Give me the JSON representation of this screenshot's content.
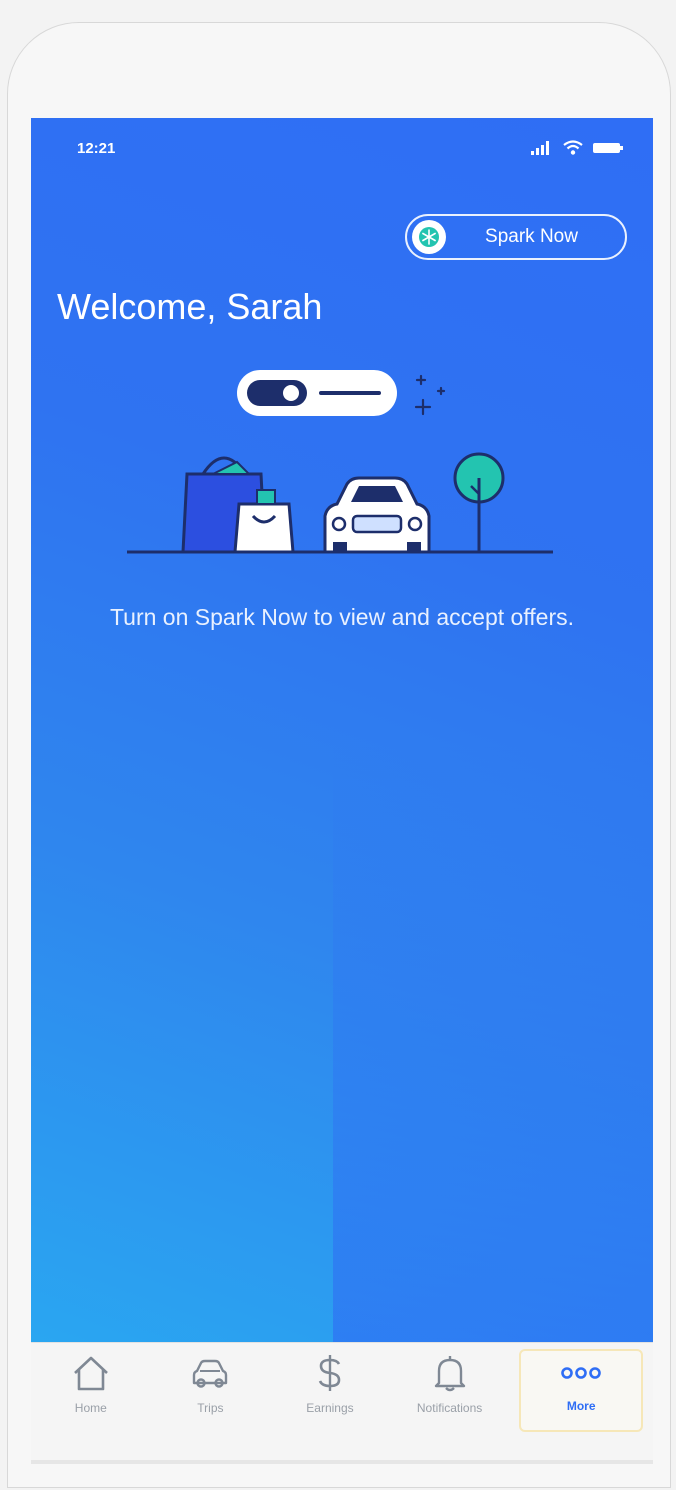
{
  "status_bar": {
    "time": "12:21"
  },
  "spark_toggle": {
    "label": "Spark Now",
    "icon": "snowflake-icon"
  },
  "greeting": "Welcome, Sarah",
  "prompt": "Turn on Spark Now to view and accept offers.",
  "tabs": [
    {
      "label": "Home",
      "icon": "home-icon"
    },
    {
      "label": "Trips",
      "icon": "car-icon"
    },
    {
      "label": "Earnings",
      "icon": "dollar-icon"
    },
    {
      "label": "Notifications",
      "icon": "bell-icon"
    },
    {
      "label": "More",
      "icon": "more-dots-icon"
    }
  ],
  "colors": {
    "screen_blue": "#2f6ef5",
    "screen_light_blue": "#2aa6f1",
    "accent_teal": "#23c4b0",
    "active_tab": "#2f6ef5",
    "active_tab_border": "#f6e7b8"
  }
}
